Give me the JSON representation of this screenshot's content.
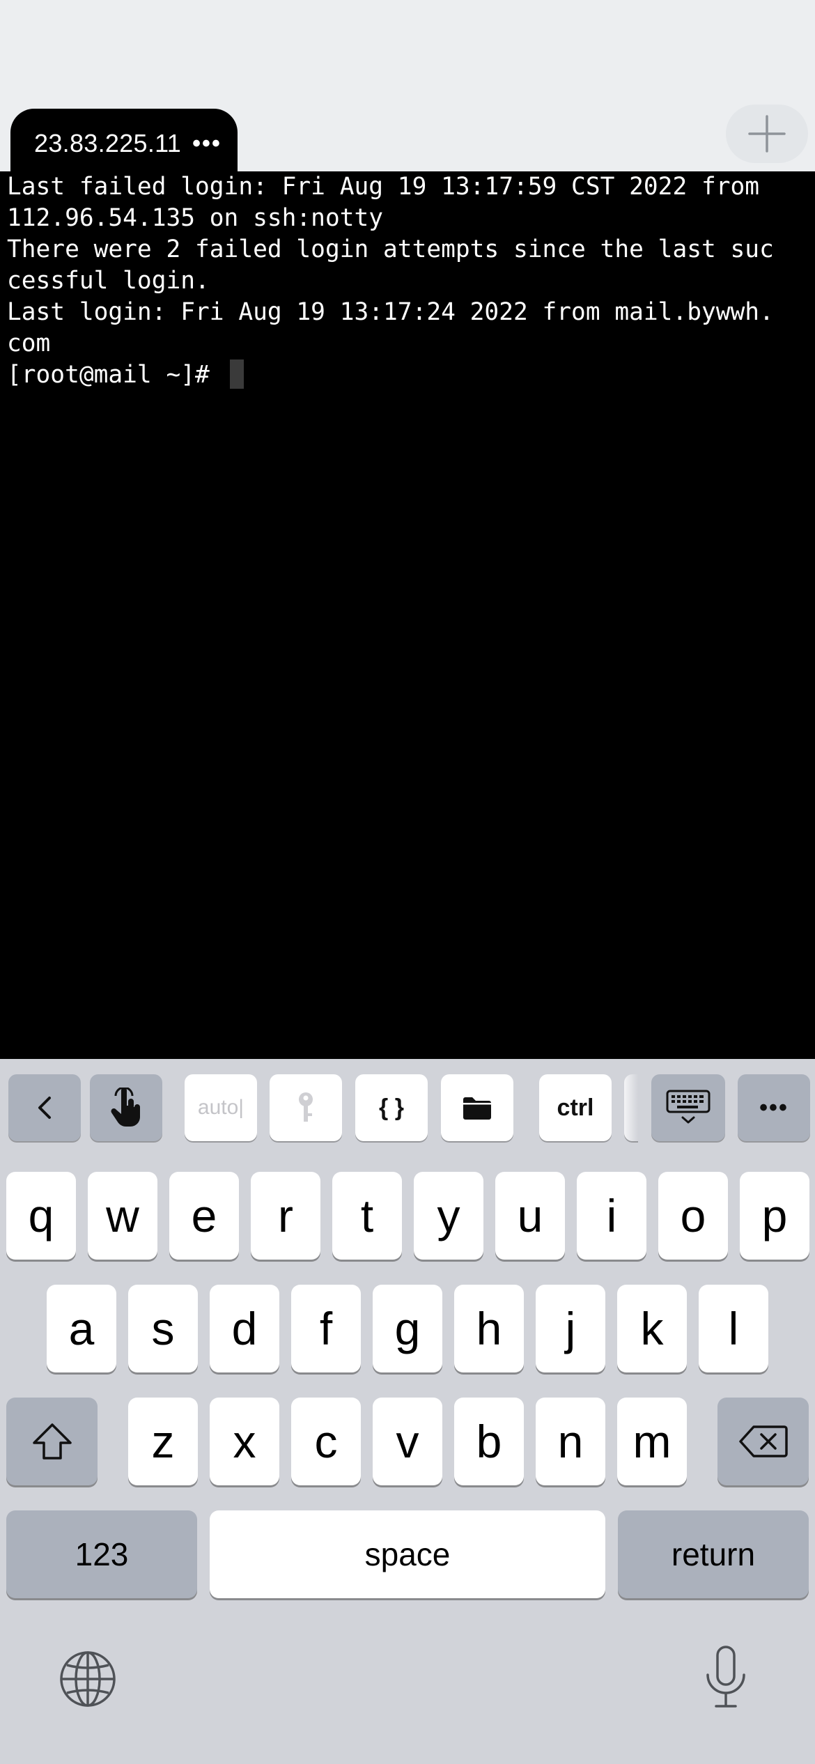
{
  "tab": {
    "title": "23.83.225.11",
    "more": "•••"
  },
  "terminal": {
    "lines": [
      "Last failed login: Fri Aug 19 13:17:59 CST 2022 from",
      "112.96.54.135 on ssh:notty",
      "There were 2 failed login attempts since the last suc",
      "cessful login.",
      "Last login: Fri Aug 19 13:17:24 2022 from mail.bywwh.",
      "com"
    ],
    "prompt": "[root@mail ~]# "
  },
  "accessory": {
    "auto_label": "auto|",
    "braces_label": "{ }",
    "ctrl_label": "ctrl",
    "more_label": "•••"
  },
  "keyboard": {
    "row1": [
      "q",
      "w",
      "e",
      "r",
      "t",
      "y",
      "u",
      "i",
      "o",
      "p"
    ],
    "row2": [
      "a",
      "s",
      "d",
      "f",
      "g",
      "h",
      "j",
      "k",
      "l"
    ],
    "row3": [
      "z",
      "x",
      "c",
      "v",
      "b",
      "n",
      "m"
    ],
    "numbers_label": "123",
    "space_label": "space",
    "return_label": "return"
  },
  "colors": {
    "terminal_bg": "#000000",
    "terminal_text": "#ffffff",
    "keyboard_bg": "#d1d3d9",
    "key_gray": "#abb1bc",
    "topbar_bg": "#eceef0"
  }
}
